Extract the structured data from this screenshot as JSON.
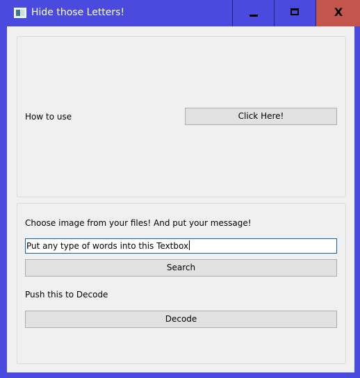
{
  "window": {
    "title": "Hide those Letters!",
    "icon": "app-window-icon",
    "controls": {
      "minimize_icon": "minimize-icon",
      "maximize_icon": "maximize-icon",
      "close_label": "X"
    }
  },
  "help_group": {
    "how_to_use_label": "How to use",
    "click_here_button": "Click Here!"
  },
  "encode_group": {
    "choose_image_label": "Choose image from your files! And put your message!",
    "message_input_value": "Put any type of words into this Textbox",
    "search_button": "Search",
    "decode_label": "Push this to Decode",
    "decode_button": "Decode"
  },
  "colors": {
    "titlebar": "#4a4adf",
    "close_button": "#c4554d",
    "client_background": "#f0f0f0",
    "button_face": "#e1e1e1",
    "input_border": "#0a63a8"
  }
}
